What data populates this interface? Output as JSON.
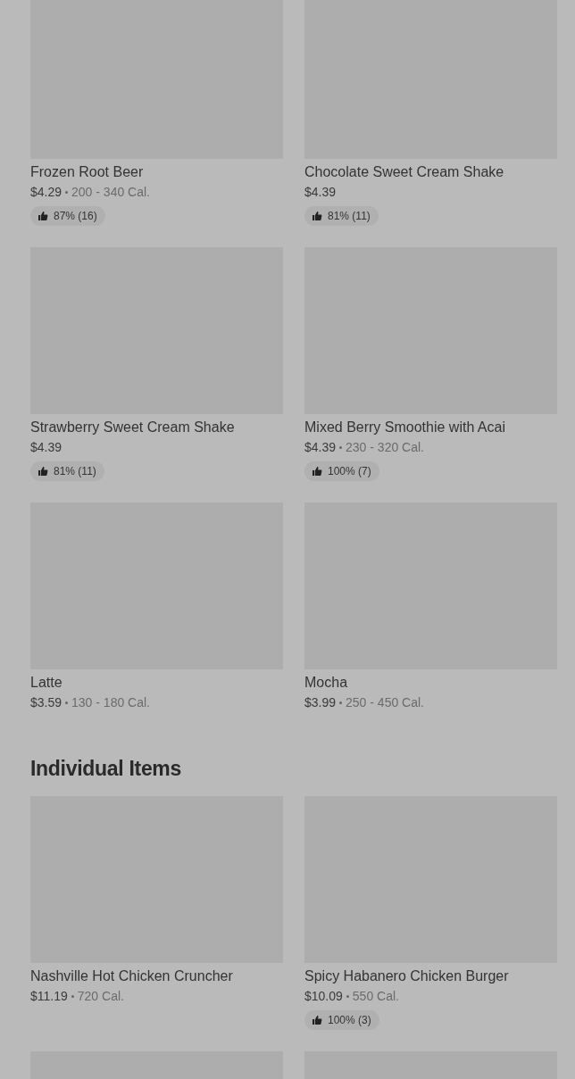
{
  "sections": [
    {
      "items": [
        {
          "kind": "item",
          "name": "Frozen Root Beer",
          "price": "$4.29",
          "calories": "200 - 340 Cal.",
          "rating": "87% (16)"
        },
        {
          "kind": "item",
          "name": "Chocolate Sweet Cream Shake",
          "price": "$4.39",
          "rating": "81% (11)"
        },
        {
          "kind": "item",
          "name": "Strawberry Sweet Cream Shake",
          "price": "$4.39",
          "rating": "81% (11)"
        },
        {
          "kind": "item",
          "name": "Mixed Berry Smoothie with Acai",
          "price": "$4.39",
          "calories": "230 - 320 Cal.",
          "rating": "100% (7)"
        },
        {
          "kind": "item",
          "name": "Latte",
          "price": "$3.59",
          "calories": "130 - 180 Cal."
        },
        {
          "kind": "item",
          "name": "Mocha",
          "price": "$3.99",
          "calories": "250 - 450 Cal."
        }
      ]
    },
    {
      "title": "Individual Items",
      "items": [
        {
          "kind": "item",
          "name": "Nashville Hot Chicken Cruncher",
          "price": "$11.19",
          "calories": "720 Cal."
        },
        {
          "kind": "item",
          "name": "Spicy Habanero Chicken Burger",
          "price": "$10.09",
          "calories": "550 Cal.",
          "rating": "100% (3)"
        },
        {
          "kind": "image-only"
        },
        {
          "kind": "image-only"
        }
      ]
    }
  ]
}
